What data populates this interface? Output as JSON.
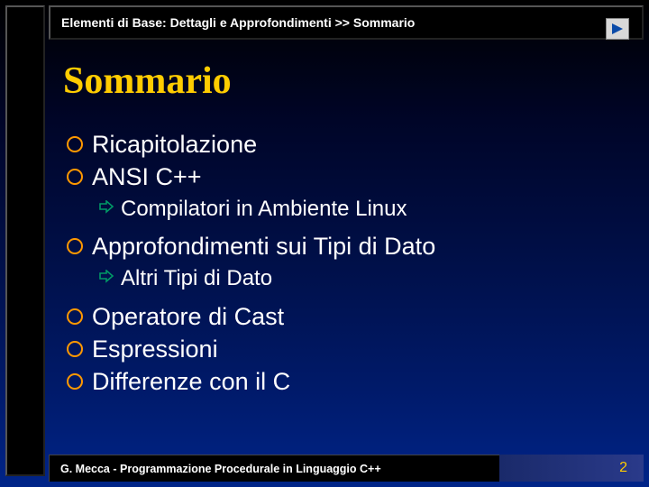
{
  "breadcrumb": "Elementi di Base: Dettagli e Approfondimenti >> Sommario",
  "title": "Sommario",
  "items": [
    {
      "label": "Ricapitolazione",
      "children": []
    },
    {
      "label": "ANSI C++",
      "children": [
        {
          "label": "Compilatori in Ambiente Linux"
        }
      ]
    },
    {
      "label": "Approfondimenti sui Tipi di Dato",
      "children": [
        {
          "label": "Altri Tipi di Dato"
        }
      ]
    },
    {
      "label": "Operatore di Cast",
      "children": []
    },
    {
      "label": "Espressioni",
      "children": []
    },
    {
      "label": "Differenze con il C",
      "children": []
    }
  ],
  "footer": "G. Mecca - Programmazione Procedurale in Linguaggio C++",
  "page_number": "2",
  "colors": {
    "accent": "#ffcc00",
    "bullet_ring": "#ff9900",
    "arrow": "#009966"
  }
}
